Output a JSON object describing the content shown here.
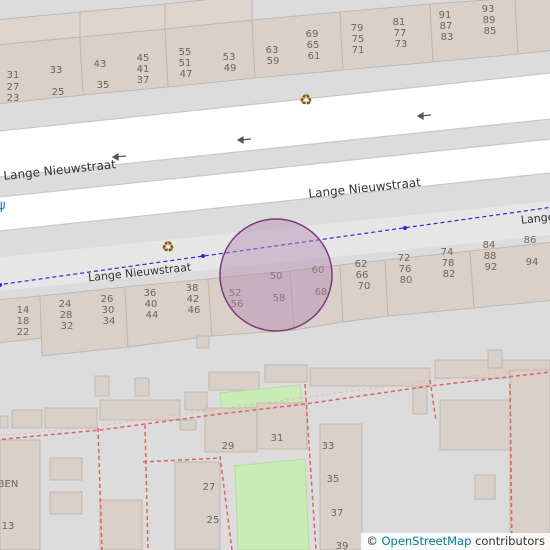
{
  "map": {
    "streets": {
      "main": "Lange Nieuwstraat",
      "upper": "Lange Nieuwstraat",
      "lower": "Lange Nieuwstraat",
      "right_partial": "Lange"
    },
    "house_numbers": {
      "top_row": [
        "31",
        "27",
        "23",
        "33",
        "25",
        "43",
        "35",
        "45",
        "41",
        "37",
        "55",
        "51",
        "47",
        "53",
        "49",
        "63",
        "59",
        "69",
        "65",
        "61",
        "79",
        "75",
        "71",
        "81",
        "77",
        "73",
        "91",
        "87",
        "83",
        "93",
        "89",
        "85"
      ],
      "bottom_row": [
        "14",
        "18",
        "22",
        "24",
        "28",
        "32",
        "26",
        "30",
        "34",
        "36",
        "40",
        "44",
        "38",
        "42",
        "46",
        "52",
        "56",
        "50",
        "58",
        "60",
        "68",
        "62",
        "66",
        "70",
        "72",
        "76",
        "80",
        "74",
        "78",
        "82",
        "84",
        "88",
        "92",
        "86",
        "94"
      ],
      "lower_area": [
        "29",
        "31",
        "27",
        "25",
        "33",
        "35",
        "37",
        "39",
        "13",
        "BEN"
      ]
    },
    "icons": [
      "recycling-icon",
      "recycling-icon",
      "direction-arrow-icon",
      "bicycle-route-icon"
    ],
    "colors": {
      "background": "#dcdcdc",
      "building": "#d9d0c9",
      "road": "#ffffff",
      "route": "#2a2ad6",
      "circle_fill": "#b48ab4",
      "circle_stroke": "#7a3c7a",
      "park": "#c9ecb4",
      "boundary": "#e06060",
      "recycling": "#8a5a10"
    }
  },
  "attribution": {
    "copyright_symbol": "©",
    "link_text": "OpenStreetMap",
    "suffix": "contributors"
  }
}
